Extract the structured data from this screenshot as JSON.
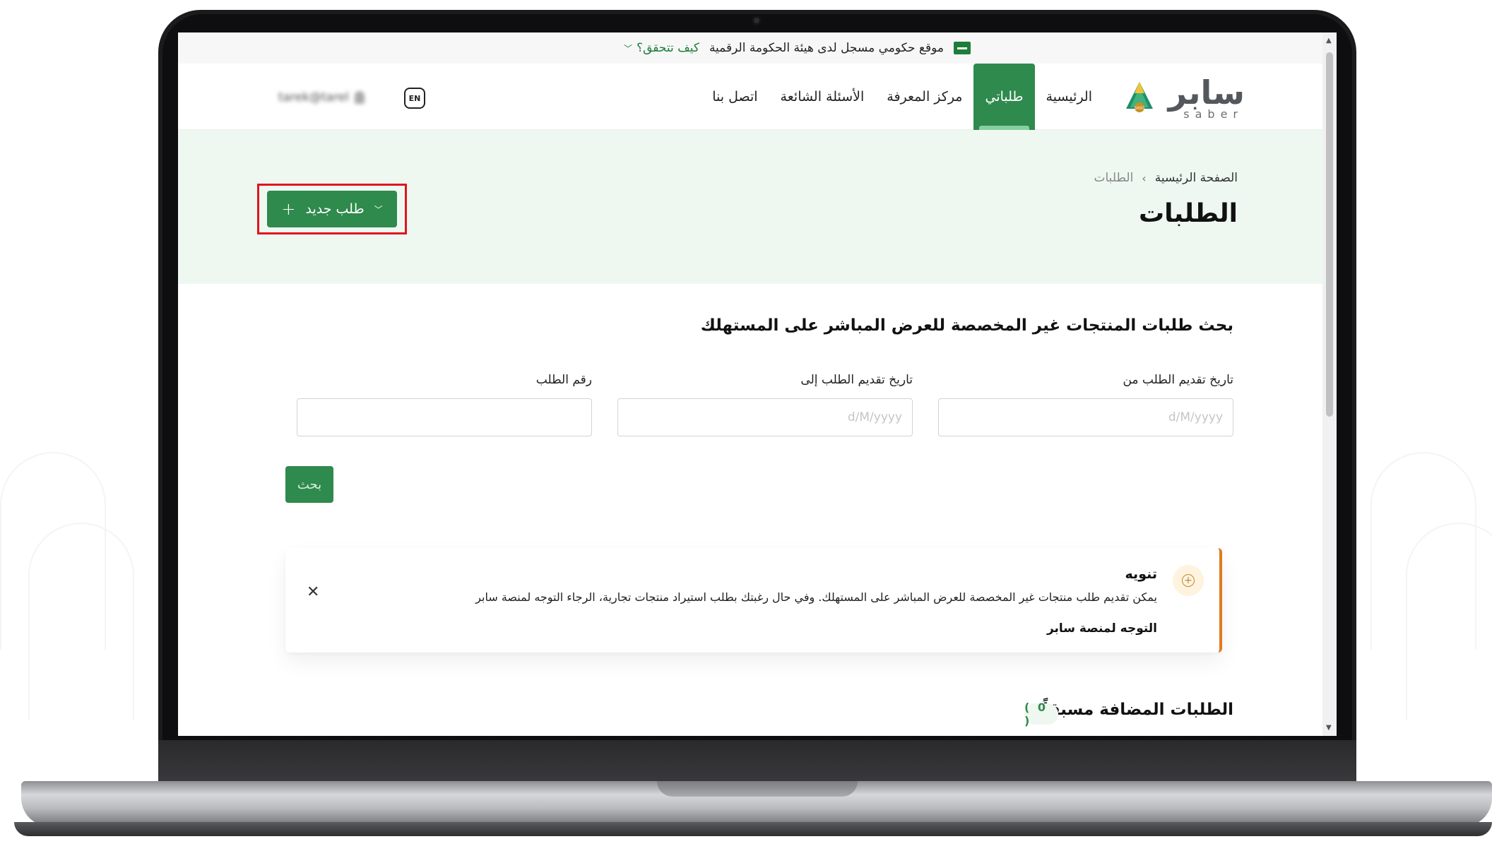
{
  "gov_bar": {
    "text": "موقع حكومي مسجل لدى هيئة الحكومة الرقمية",
    "link": "كيف تتحقق؟"
  },
  "nav": {
    "logo_text": "سابر",
    "logo_sub": "saber",
    "logo_badge": "SASO",
    "items": [
      {
        "label": "الرئيسية"
      },
      {
        "label": "طلباتي"
      },
      {
        "label": "مركز المعرفة"
      },
      {
        "label": "الأسئلة الشائعة"
      },
      {
        "label": "اتصل بنا"
      }
    ],
    "active_item": "طلباتي",
    "lang_label": "EN",
    "user_email": "tarek@tarel"
  },
  "hero": {
    "breadcrumb_home": "الصفحة الرئيسية",
    "breadcrumb_current": "الطلبات",
    "title": "الطلبات",
    "new_request_label": "طلب جديد"
  },
  "search": {
    "title": "بحث طلبات المنتجات غير المخصصة للعرض المباشر على المستهلك",
    "date_from_label": "تاريخ تقديم الطلب من",
    "date_from_placeholder": "d/M/yyyy",
    "date_to_label": "تاريخ تقديم الطلب إلى",
    "date_to_placeholder": "d/M/yyyy",
    "request_number_label": "رقم الطلب",
    "request_number_value": "",
    "submit_label": "بحث"
  },
  "alert": {
    "title": "تنويه",
    "body": "يمكن تقديم طلب منتجات غير المخصصة للعرض المباشر على المستهلك. وفي حال رغبتك بطلب استيراد منتجات تجارية، الرجاء التوجه لمنصة سابر",
    "link": "التوجه لمنصة سابر"
  },
  "list": {
    "title": "الطلبات المضافة مسبقاً",
    "count": "( 0 )"
  },
  "colors": {
    "brand_green": "#2f8a4d",
    "hero_bg": "#eef8f1",
    "alert_accent": "#e07a1f",
    "highlight_frame": "#e0151d"
  }
}
